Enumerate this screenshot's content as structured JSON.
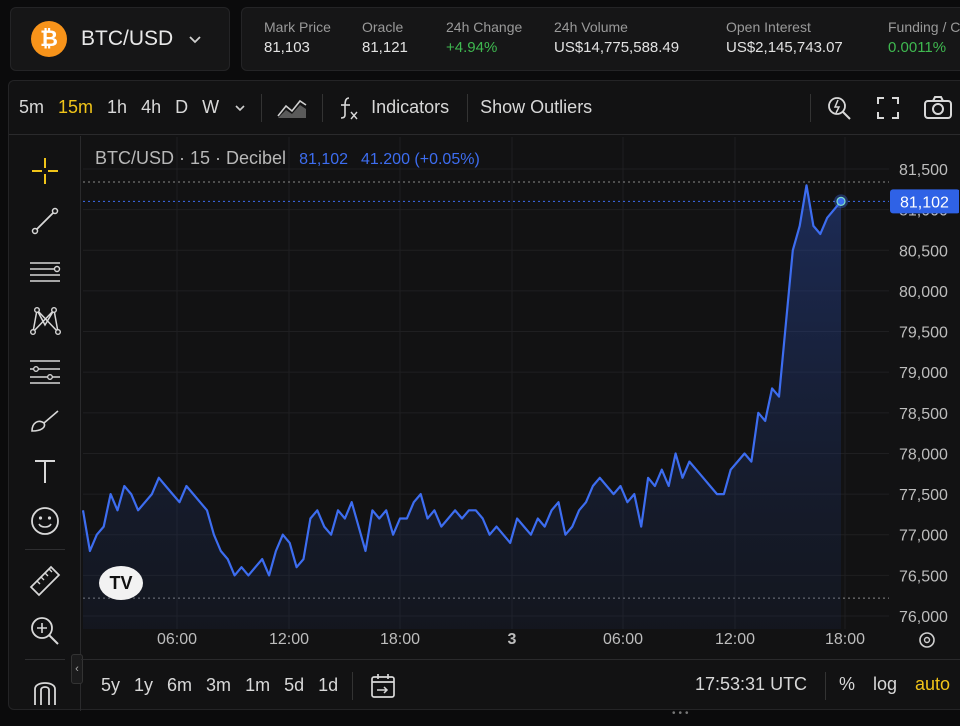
{
  "pair": {
    "symbol": "BTC/USD",
    "icon": "bitcoin-icon",
    "icon_glyph": "₿"
  },
  "stats": [
    {
      "label": "Mark Price",
      "value": "81,103",
      "color": ""
    },
    {
      "label": "Oracle",
      "value": "81,121",
      "color": ""
    },
    {
      "label": "24h Change",
      "value": "+4.94%",
      "color": "green"
    },
    {
      "label": "24h Volume",
      "value": "US$14,775,588.49",
      "color": ""
    },
    {
      "label": "Open Interest",
      "value": "US$2,145,743.07",
      "color": ""
    },
    {
      "label": "Funding / C",
      "value": "0.0011%",
      "color": "green"
    }
  ],
  "toolbar": {
    "intervals": [
      "5m",
      "15m",
      "1h",
      "4h",
      "D",
      "W"
    ],
    "active_interval": "15m",
    "indicators_label": "Indicators",
    "outliers_label": "Show Outliers"
  },
  "legend": {
    "title": "BTC/USD · 15 · Decibel",
    "last": "81,102",
    "change": "41.200 (+0.05%)"
  },
  "price_tag": "81,102",
  "bottombar": {
    "ranges": [
      "5y",
      "1y",
      "6m",
      "3m",
      "1m",
      "5d",
      "1d"
    ],
    "time": "17:53:31 UTC",
    "percent": "%",
    "log": "log",
    "auto": "auto"
  },
  "tv_logo": "TV",
  "colors": {
    "accent": "#3d6df0",
    "active": "#f0c419",
    "positive": "#3fb950",
    "btc": "#f7931a"
  },
  "chart_data": {
    "type": "area",
    "y_ticks": [
      "81,500",
      "81,000",
      "80,500",
      "80,000",
      "79,500",
      "79,000",
      "78,500",
      "78,000",
      "77,500",
      "77,000",
      "76,500",
      "76,000"
    ],
    "x_ticks": [
      "06:00",
      "12:00",
      "18:00",
      "3",
      "06:00",
      "12:00",
      "18:00"
    ],
    "ylim": [
      76000,
      81800
    ],
    "high_line": 81340,
    "low_line": 76220,
    "grid": true,
    "series": [
      {
        "values": [
          77300,
          76800,
          77000,
          77100,
          77500,
          77300,
          77600,
          77500,
          77300,
          77400,
          77500,
          77700,
          77600,
          77500,
          77400,
          77600,
          77500,
          77400,
          77300,
          77000,
          76800,
          76700,
          76500,
          76600,
          76500,
          76600,
          76700,
          76500,
          76800,
          77000,
          76900,
          76600,
          76700,
          77200,
          77300,
          77100,
          77000,
          77300,
          77200,
          77400,
          77100,
          76800,
          77300,
          77200,
          77300,
          77000,
          77200,
          77200,
          77400,
          77500,
          77200,
          77300,
          77100,
          77200,
          77300,
          77200,
          77300,
          77300,
          77200,
          77000,
          77100,
          77000,
          76900,
          77200,
          77100,
          77000,
          77200,
          77100,
          77300,
          77400,
          77000,
          77100,
          77300,
          77400,
          77600,
          77700,
          77600,
          77500,
          77600,
          77400,
          77500,
          77100,
          77700,
          77600,
          77800,
          77600,
          78000,
          77700,
          77900,
          77800,
          77700,
          77600,
          77500,
          77500,
          77800,
          77900,
          78000,
          77900,
          78500,
          78400,
          78800,
          78700,
          79600,
          80500,
          80800,
          81300,
          80800,
          80700,
          80900,
          81000,
          81102
        ]
      }
    ]
  }
}
